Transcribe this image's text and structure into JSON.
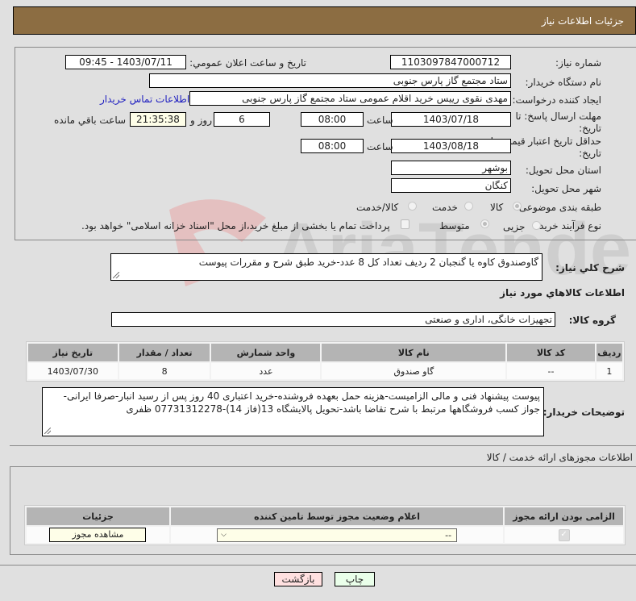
{
  "header": {
    "title": "جزئیات اطلاعات نیاز"
  },
  "form": {
    "need_number": {
      "label": "شماره نیاز:",
      "value": "1103097847000712"
    },
    "announce_datetime": {
      "label": "تاريخ و ساعت اعلان عمومي:",
      "value": "1403/07/11 - 09:45"
    },
    "buyer_org": {
      "label": "نام دستگاه خريدار:",
      "value": "ستاد مجتمع گاز پارس جنوبی"
    },
    "requester": {
      "label": "ايجاد کننده درخواست:",
      "value": "مهدی نقوی رییس خرید اقلام عمومی ستاد مجتمع گاز پارس جنوبی",
      "contact_link": "اطلاعات تماس خريدار"
    },
    "reply_deadline": {
      "label": "مهلت ارسال پاسخ: تا تاریخ:",
      "date": "1403/07/18",
      "time_label": "ساعت",
      "time": "08:00",
      "days": "6",
      "days_label": "روز و",
      "remaining": "21:35:38",
      "remaining_label": "ساعت باقي مانده"
    },
    "price_validity": {
      "label": "حداقل تاريخ اعتبار قيمت: تا تاریخ:",
      "date": "1403/08/18",
      "time_label": "ساعت",
      "time": "08:00"
    },
    "province": {
      "label": "استان محل تحويل:",
      "value": "بوشهر"
    },
    "city": {
      "label": "شهر محل تحويل:",
      "value": "کنگان"
    },
    "category": {
      "label": "طبقه بندی موضوعی:",
      "options": [
        {
          "label": "کالا",
          "checked": true
        },
        {
          "label": "خدمت",
          "checked": false
        },
        {
          "label": "کالا/خدمت",
          "checked": false
        }
      ]
    },
    "process_type": {
      "label": "نوع فرآيند خريد :",
      "options": [
        {
          "label": "جزیی",
          "checked": false
        },
        {
          "label": "متوسط",
          "checked": true
        }
      ],
      "treasury_checkbox": {
        "label": "پرداخت تمام يا بخشی از مبلغ خريد،از محل \"اسناد خزانه اسلامی\" خواهد بود.",
        "checked": false
      }
    }
  },
  "summary": {
    "label": "شرح كلي نياز:",
    "value": "گاوصندوق کاوه یا گنجبان 2 ردیف تعداد کل 8 عدد-خرید طبق شرح و مقررات پیوست"
  },
  "goods_section": {
    "title": "اطلاعات كالاهاي مورد نياز",
    "group_label": "گروه كالا:",
    "group_value": "تجهیزات خانگی، اداری و صنعتی",
    "table": {
      "headers": [
        "رديف",
        "کد کالا",
        "نام کالا",
        "واحد شمارش",
        "تعداد / مقدار",
        "تاریخ نیاز"
      ],
      "rows": [
        [
          "1",
          "--",
          "گاو صندوق",
          "عدد",
          "8",
          "1403/07/30"
        ]
      ]
    }
  },
  "buyer_notes": {
    "label": "توضيحات خريدار:",
    "value": "پیوست پیشنهاد فنی و مالی الزامیست-هزینه حمل بعهده فروشنده-خرید اعتباری 40 روز پس از رسید انبار-صرفا ایرانی-جواز کسب فروشگاهها مرتبط با شرح تقاضا باشد-تحویل پالایشگاه 13(فاز 14)-07731312278 ظفری"
  },
  "permits": {
    "title": "اطلاعات مجوزهای ارائه خدمت / کالا",
    "table": {
      "headers": [
        "الزامی بودن ارائه مجوز",
        "اعلام وضعیت مجوز توسط تامین کننده",
        "جزئیات"
      ],
      "rows": [
        {
          "required_checked": true,
          "status_value": "--",
          "details_button": "مشاهده مجوز"
        }
      ]
    }
  },
  "footer": {
    "print_button": "چاپ",
    "back_button": "بازگشت"
  },
  "watermark": {
    "text": "AriaTender.neT"
  }
}
